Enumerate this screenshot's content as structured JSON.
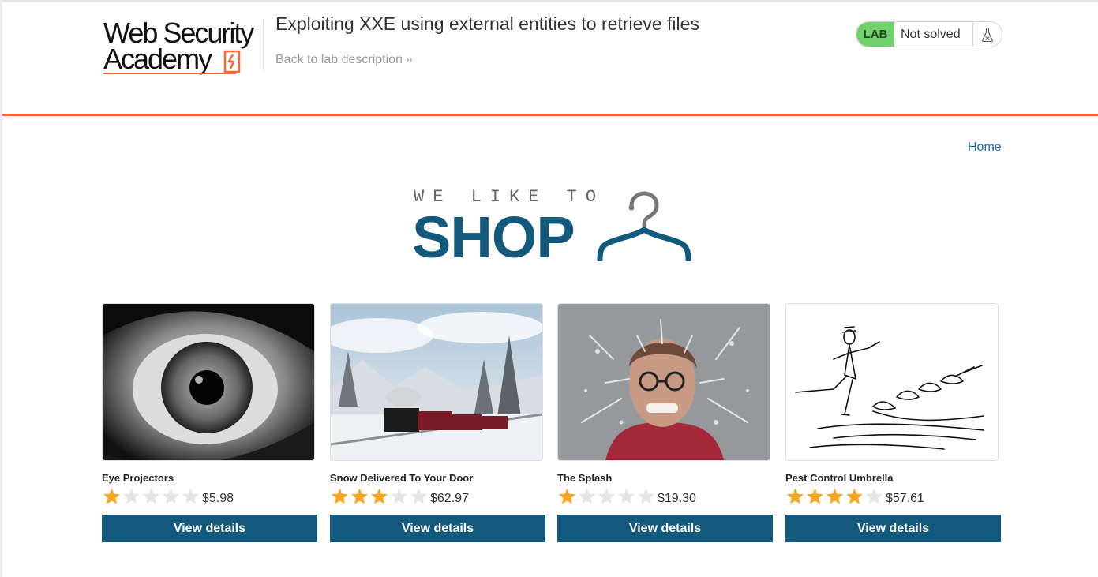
{
  "header": {
    "logo_line1": "Web Security",
    "logo_line2": "Academy",
    "lab_title": "Exploiting XXE using external entities to retrieve files",
    "back_link": "Back to lab description",
    "lab_badge": "LAB",
    "lab_status": "Not solved"
  },
  "nav": {
    "home": "Home"
  },
  "banner": {
    "tagline": "WE LIKE TO",
    "word": "SHOP"
  },
  "products": [
    {
      "name": "Eye Projectors",
      "price": "$5.98",
      "rating": 1,
      "button": "View details",
      "image_icon": "eye-photo"
    },
    {
      "name": "Snow Delivered To Your Door",
      "price": "$62.97",
      "rating": 3,
      "button": "View details",
      "image_icon": "snow-train-photo"
    },
    {
      "name": "The Splash",
      "price": "$19.30",
      "rating": 1,
      "button": "View details",
      "image_icon": "splash-photo"
    },
    {
      "name": "Pest Control Umbrella",
      "price": "$57.61",
      "rating": 4,
      "button": "View details",
      "image_icon": "umbrella-cats-sketch"
    }
  ],
  "colors": {
    "accent_orange": "#ff6633",
    "brand_blue": "#13597c",
    "lab_green": "#70d16d",
    "star_filled": "#f5a623",
    "star_empty": "#e3e6e8"
  }
}
